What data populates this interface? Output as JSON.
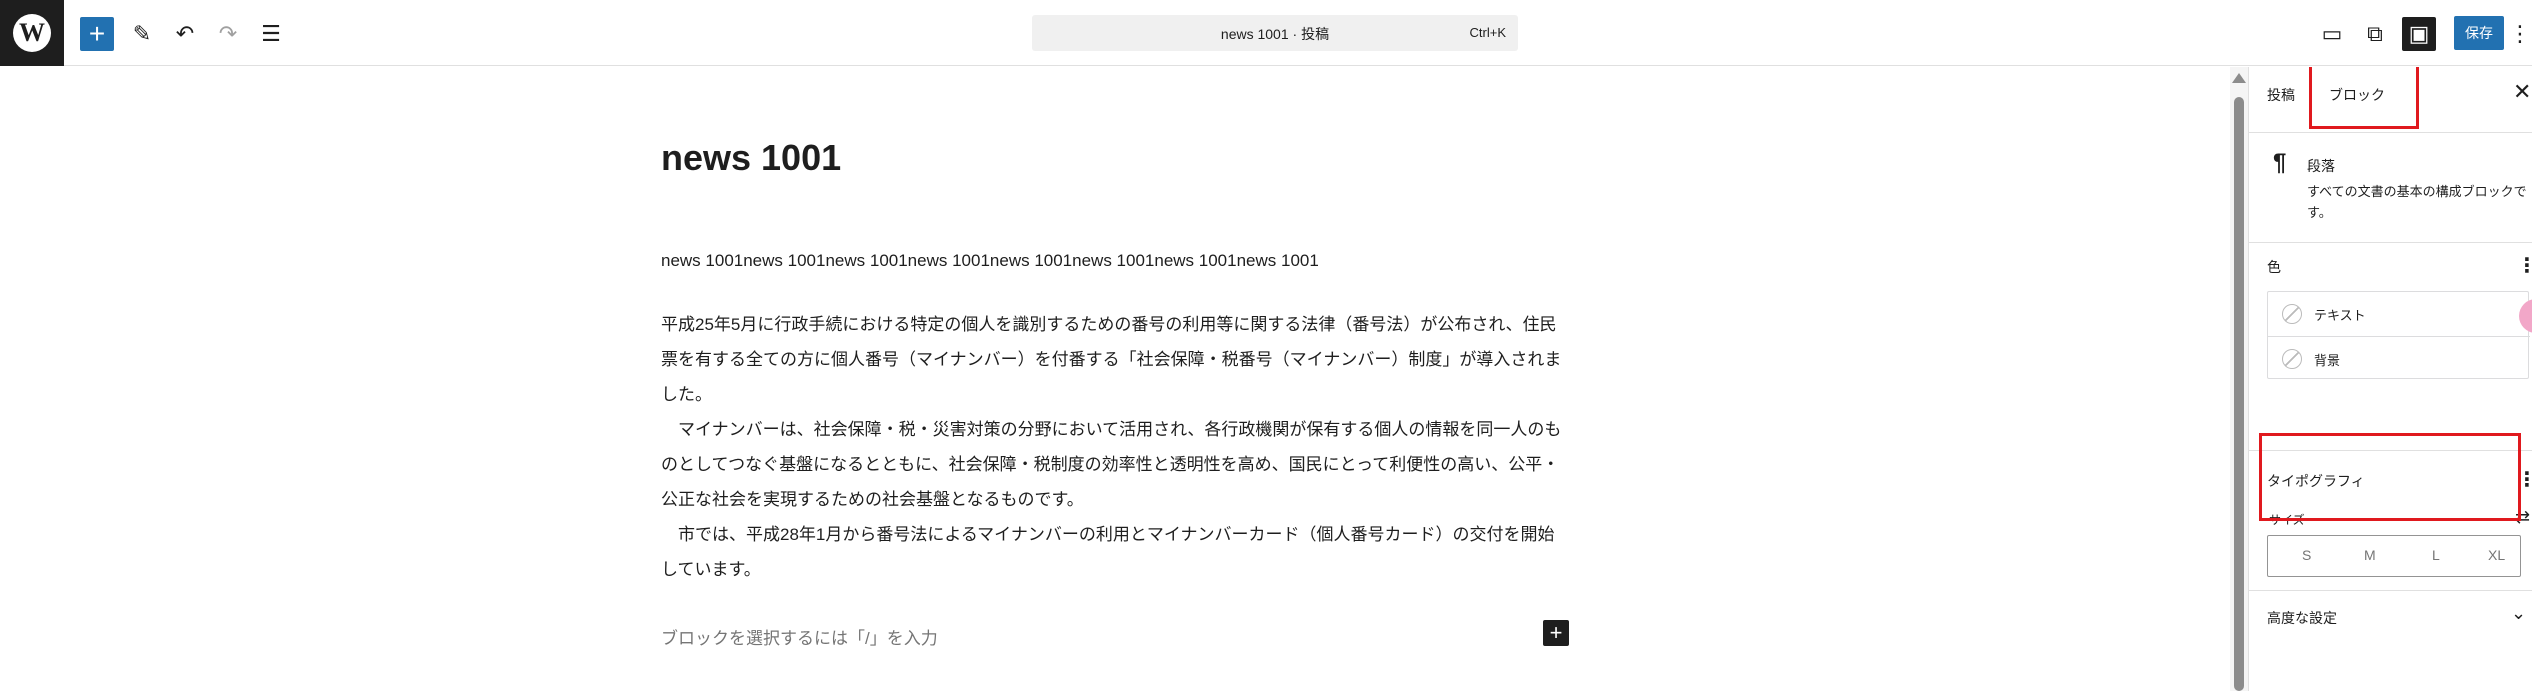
{
  "toolbar": {
    "logo": "W",
    "icons": [
      "wordpress-logo",
      "plus-icon",
      "pencil-icon",
      "undo-icon",
      "redo-icon",
      "list-view-icon",
      "desktop-icon",
      "external-link-icon",
      "sidebar-icon",
      "kebab-icon"
    ],
    "add_symbol": "+",
    "tool_symbol": "✎",
    "undo_symbol": "↶",
    "redo_symbol": "↷",
    "list_symbol": "☰",
    "document_title": "news 1001 · 投稿",
    "shortcut": "Ctrl+K",
    "preview_symbol": "▭",
    "view_symbol": "⧉",
    "settings_symbol": "▣",
    "save_label": "保存",
    "more_symbol": "⋮"
  },
  "editor": {
    "post_title": "news 1001",
    "paragraph1": "news 1001news 1001news 1001news 1001news 1001news 1001news 1001news 1001",
    "paragraph2": "平成25年5月に行政手続における特定の個人を識別するための番号の利用等に関する法律（番号法）が公布され、住民票を有する全ての方に個人番号（マイナンバー）を付番する「社会保障・税番号（マイナンバー）制度」が導入されました。\n　マイナンバーは、社会保障・税・災害対策の分野において活用され、各行政機関が保有する個人の情報を同一人のものとしてつなぐ基盤になるとともに、社会保障・税制度の効率性と透明性を高め、国民にとって利便性の高い、公平・公正な社会を実現するための社会基盤となるものです。\n　市では、平成28年1月から番号法によるマイナンバーの利用とマイナンバーカード（個人番号カード）の交付を開始しています。",
    "placeholder": "ブロックを選択するには「/」を入力",
    "inline_add_symbol": "+"
  },
  "sidebar": {
    "tab_post": "投稿",
    "tab_block": "ブロック",
    "close_symbol": "✕",
    "block_icon": "¶",
    "block_name": "段落",
    "block_description": "すべての文書の基本の構成ブロックです。",
    "color": {
      "title": "色",
      "more_symbol": "⋮",
      "text_label": "テキスト",
      "background_label": "背景"
    },
    "typography": {
      "title": "タイポグラフィ",
      "more_symbol": "⋮",
      "size_label": "サイズ",
      "adjust_symbol": "⇄",
      "sizes": [
        "S",
        "M",
        "L",
        "XL"
      ]
    },
    "advanced": {
      "label": "高度な設定",
      "chevron_symbol": "⌄"
    }
  },
  "colors": {
    "accent": "#2271b1",
    "highlight": "#e0191e",
    "dark": "#1e1e1e"
  }
}
